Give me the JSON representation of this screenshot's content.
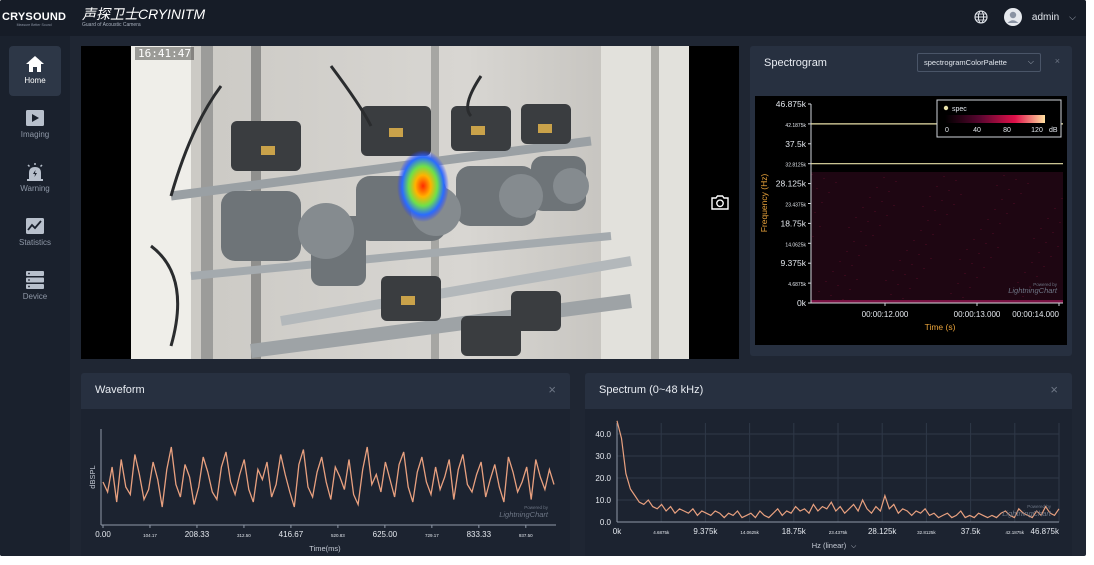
{
  "brand": {
    "logo": "CRYSOUND",
    "logo_tagline": "Measure Better Sound",
    "product_name": "声探卫士CRYINITM",
    "product_subtitle": "Guard of Acoustic Camera"
  },
  "user": {
    "name": "admin"
  },
  "icons": {
    "language": "globe-icon",
    "user": "user-avatar-icon",
    "menu": "chevron-down-icon",
    "snapshot": "camera-icon",
    "close": "close-icon"
  },
  "nav": {
    "items": [
      {
        "label": "Home",
        "icon": "home-icon",
        "active": true
      },
      {
        "label": "Imaging",
        "icon": "play-icon",
        "active": false
      },
      {
        "label": "Warning",
        "icon": "alarm-icon",
        "active": false
      },
      {
        "label": "Statistics",
        "icon": "chart-icon",
        "active": false
      },
      {
        "label": "Device",
        "icon": "server-icon",
        "active": false
      }
    ]
  },
  "camera": {
    "timestamp": "16:41:47"
  },
  "spectrogram": {
    "title": "Spectrogram",
    "palette_placeholder": "spectrogramColorPalette",
    "close": "×"
  },
  "waveform": {
    "title": "Waveform",
    "close": "×"
  },
  "spectrum": {
    "title": "Spectrum (0~48 kHz)",
    "close": "×"
  },
  "colors": {
    "background": "#1f2633",
    "panel": "#273040",
    "trace": "#e8a07f",
    "accent_line": "#e7e0a8"
  },
  "chart_data": [
    {
      "type": "heatmap",
      "title": "",
      "xlabel": "Time (s)",
      "ylabel": "Frequency (Hz)",
      "x_ticks": [
        "00:00:12.000",
        "00:00:13.000",
        "00:00:14.000"
      ],
      "y_ticks": [
        "0k",
        "4.6875k",
        "9.375k",
        "14.0625k",
        "18.75k",
        "23.4375k",
        "28.125k",
        "32.8125k",
        "37.5k",
        "42.1875k",
        "46.875k"
      ],
      "ylim": [
        0,
        46875
      ],
      "legend": {
        "series_name": "spec",
        "scale": [
          0,
          40,
          80,
          120
        ],
        "unit": "dB",
        "placement": "top-right"
      },
      "watermark": "LightningChart",
      "watermark_prefix": "Powered by"
    },
    {
      "type": "line",
      "title": "",
      "xlabel": "Time(ms)",
      "ylabel": "dBSPL",
      "x_ticks": [
        "0.00",
        "104.17",
        "208.33",
        "312.50",
        "416.67",
        "520.83",
        "625.00",
        "729.17",
        "833.33",
        "937.50"
      ],
      "xlim": [
        0,
        1000
      ],
      "watermark": "LightningChart",
      "watermark_prefix": "Powered by",
      "series": [
        {
          "values": [
            52,
            48,
            58,
            44,
            61,
            50,
            47,
            63,
            55,
            45,
            49,
            60,
            53,
            42,
            57,
            66,
            51,
            46,
            59,
            54,
            43,
            50,
            62,
            56,
            48,
            45,
            58,
            64,
            52,
            47,
            55,
            61,
            49,
            44,
            57,
            53,
            60,
            46,
            51,
            63,
            55,
            48,
            42,
            59,
            65,
            50,
            46,
            56,
            62,
            52,
            45,
            58,
            54,
            49,
            61,
            47,
            43,
            57,
            66,
            51,
            55,
            48,
            60,
            53,
            46,
            59,
            64,
            50,
            44,
            56,
            62,
            52,
            47,
            58,
            49,
            54,
            61,
            45,
            57,
            63,
            51,
            48,
            55,
            60,
            46,
            53,
            59,
            50,
            44,
            62,
            56,
            48,
            52,
            58,
            45,
            61,
            54,
            49,
            57,
            51
          ]
        }
      ]
    },
    {
      "type": "line",
      "title": "",
      "xlabel": "Hz (linear)",
      "ylabel": "",
      "x_ticks": [
        "0k",
        "4.6875k",
        "9.375k",
        "14.0625k",
        "18.75k",
        "23.4375k",
        "28.125k",
        "32.8125k",
        "37.5k",
        "42.1875k",
        "46.875k"
      ],
      "y_ticks": [
        "0.0",
        "10.0",
        "20.0",
        "30.0",
        "40.0"
      ],
      "xlim": [
        0,
        46875
      ],
      "ylim": [
        0,
        45
      ],
      "watermark": "LightningChart",
      "watermark_prefix": "Powered by",
      "series": [
        {
          "values": [
            46,
            38,
            22,
            15,
            12,
            9,
            8,
            10,
            7,
            6,
            8,
            5,
            7,
            4,
            6,
            5,
            4,
            6,
            3,
            5,
            4,
            3,
            5,
            4,
            2,
            4,
            3,
            5,
            2,
            3,
            4,
            2,
            5,
            3,
            2,
            4,
            6,
            3,
            5,
            4,
            7,
            5,
            6,
            4,
            8,
            5,
            7,
            6,
            9,
            5,
            7,
            4,
            6,
            8,
            5,
            10,
            6,
            4,
            7,
            5,
            12,
            6,
            8,
            4,
            6,
            5,
            3,
            5,
            4,
            6,
            3,
            4,
            2,
            3,
            4,
            2,
            3,
            5,
            2,
            3,
            2,
            4,
            3,
            2,
            3,
            2,
            4,
            5,
            3,
            2,
            6,
            4,
            3,
            2,
            5,
            3,
            7,
            4,
            3,
            6
          ]
        }
      ]
    }
  ]
}
